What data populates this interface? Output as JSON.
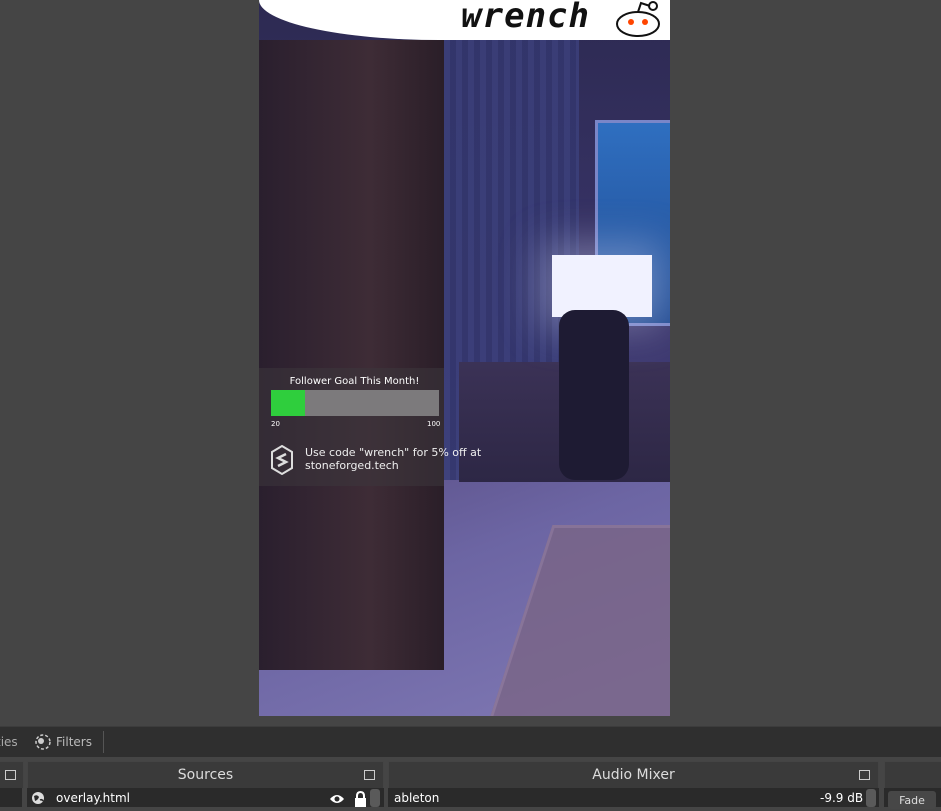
{
  "preview": {
    "banner_text": "wrench",
    "goal": {
      "title": "Follower Goal This Month!",
      "min": "20",
      "max": "100",
      "progress": 0.2,
      "fill_color": "#2fce3d"
    },
    "promo": "Use code \"wrench\" for 5% off at stoneforged.tech"
  },
  "toolbar": {
    "properties_label": "ties",
    "filters_label": "Filters"
  },
  "docks": {
    "sources": {
      "title": "Sources",
      "items": [
        {
          "name": "overlay.html",
          "icon": "globe-icon",
          "visible": true,
          "locked": true
        }
      ]
    },
    "audio_mixer": {
      "title": "Audio Mixer",
      "channels": [
        {
          "name": "ableton",
          "level": "-9.9 dB"
        }
      ]
    },
    "transitions": {
      "button": "Fade"
    }
  }
}
